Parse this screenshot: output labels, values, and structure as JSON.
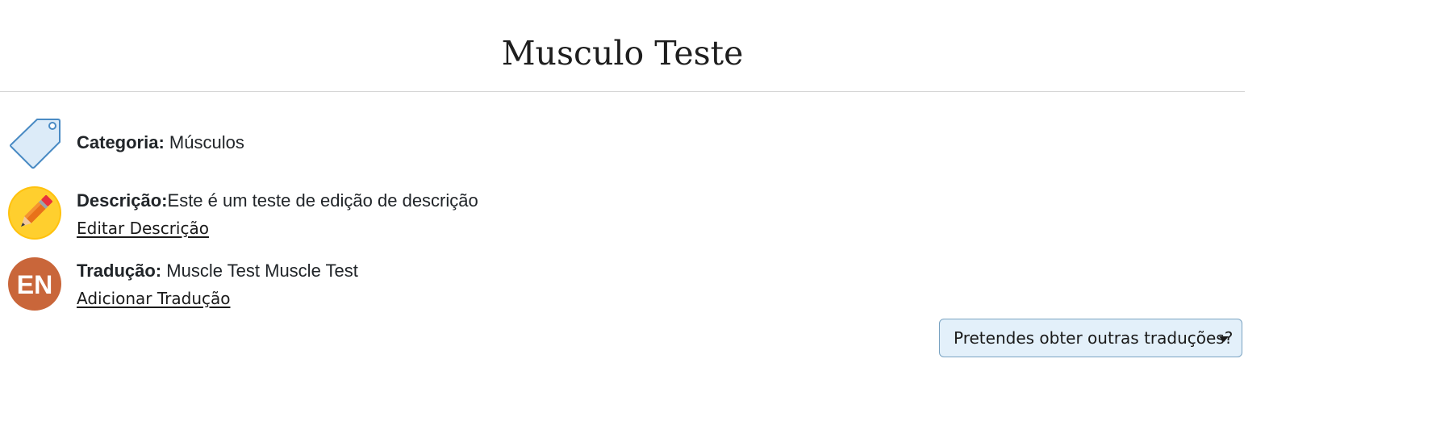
{
  "page": {
    "title": "Musculo Teste"
  },
  "category": {
    "label": "Categoria:",
    "value": "Músculos",
    "icon": "tag-icon"
  },
  "description": {
    "label": "Descrição:",
    "value": "Este é um teste de edição de descrição",
    "edit_link": "Editar Descrição",
    "icon": "pencil-icon"
  },
  "translation": {
    "label": "Tradução:",
    "value": "Muscle Test Muscle Test",
    "add_link": "Adicionar Tradução",
    "language_badge": "EN"
  },
  "translations_dropdown": {
    "label": "Pretendes obter outras traduções?"
  },
  "colors": {
    "tag_fill": "#dcebf8",
    "tag_stroke": "#4a8bc4",
    "pencil_circle": "#ffc20e",
    "language_badge": "#c9663a",
    "dropdown_bg": "#e3f0fa",
    "dropdown_border": "#7aa3c2"
  }
}
